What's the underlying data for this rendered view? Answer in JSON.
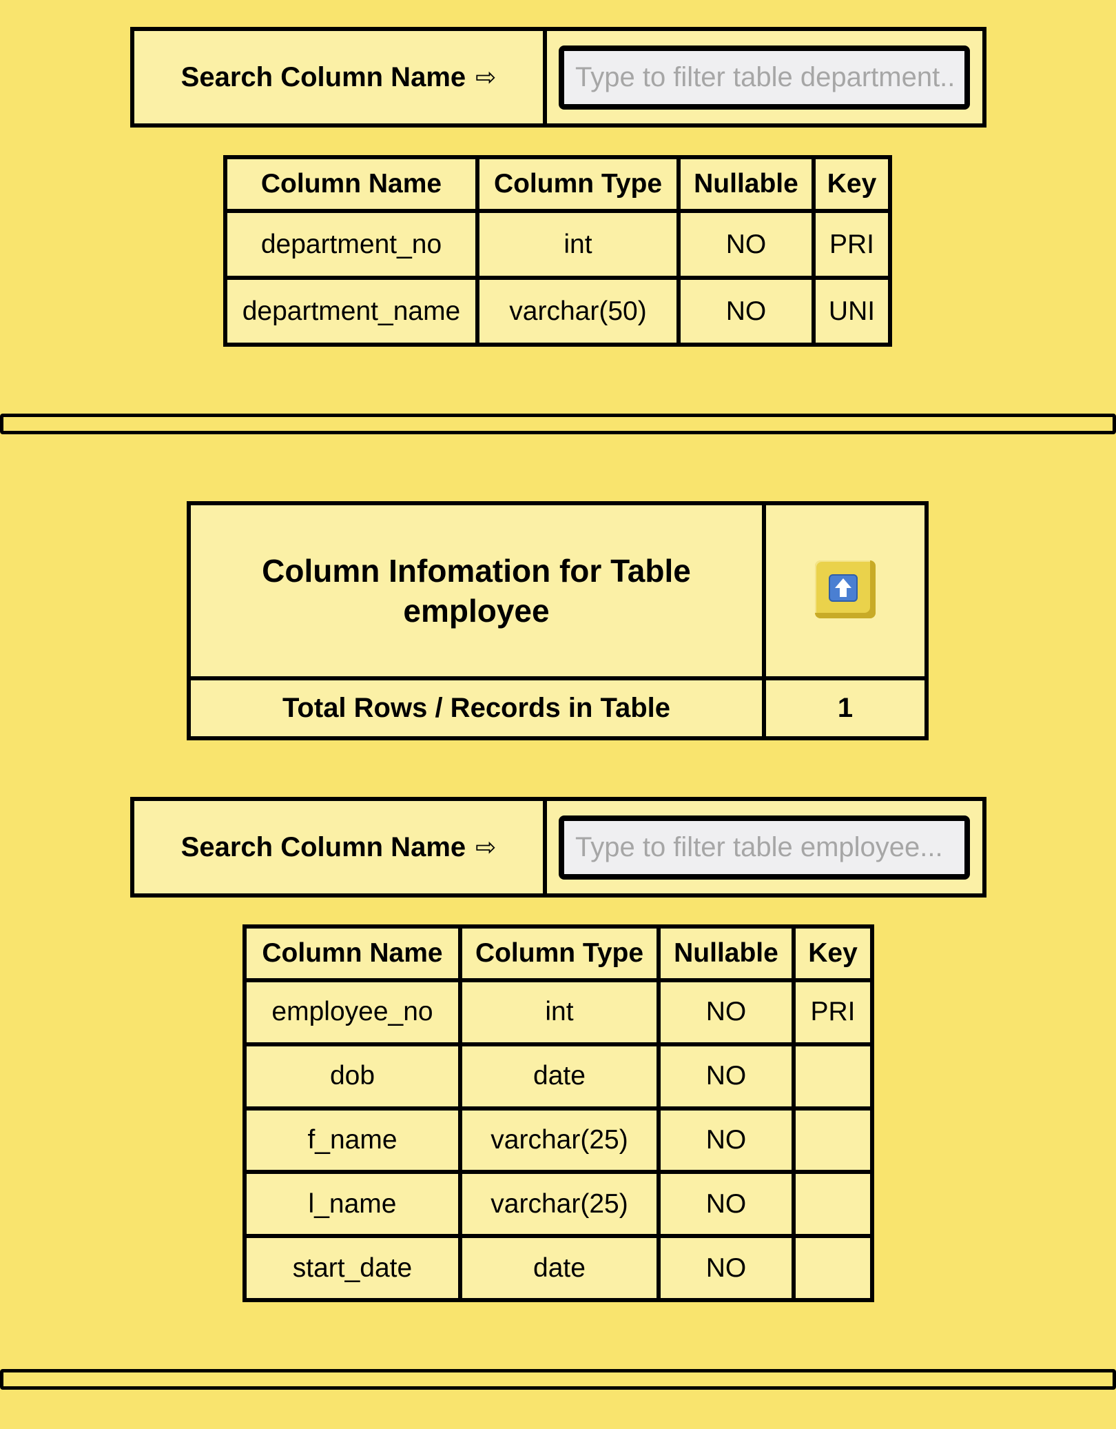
{
  "department": {
    "search": {
      "label": "Search Column Name",
      "arrow": "⇨",
      "placeholder": "Type to filter table department..."
    },
    "headers": [
      "Column Name",
      "Column Type",
      "Nullable",
      "Key"
    ],
    "rows": [
      [
        "department_no",
        "int",
        "NO",
        "PRI"
      ],
      [
        "department_name",
        "varchar(50)",
        "NO",
        "UNI"
      ]
    ]
  },
  "employee": {
    "info": {
      "title": "Column Infomation for Table employee",
      "up_icon": "arrow-up-icon",
      "rows_label": "Total Rows / Records in Table",
      "rows_value": "1"
    },
    "search": {
      "label": "Search Column Name",
      "arrow": "⇨",
      "placeholder": "Type to filter table employee..."
    },
    "headers": [
      "Column Name",
      "Column Type",
      "Nullable",
      "Key"
    ],
    "rows": [
      [
        "employee_no",
        "int",
        "NO",
        "PRI"
      ],
      [
        "dob",
        "date",
        "NO",
        ""
      ],
      [
        "f_name",
        "varchar(25)",
        "NO",
        ""
      ],
      [
        "l_name",
        "varchar(25)",
        "NO",
        ""
      ],
      [
        "start_date",
        "date",
        "NO",
        ""
      ]
    ]
  }
}
